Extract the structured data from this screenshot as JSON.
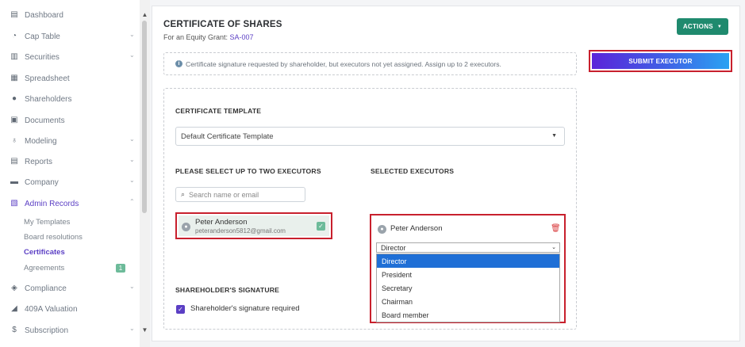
{
  "sidebar": {
    "items": [
      {
        "label": "Dashboard",
        "icon": "dashboard-icon",
        "chevron": false
      },
      {
        "label": "Cap Table",
        "icon": "pie-chart-icon",
        "chevron": true
      },
      {
        "label": "Securities",
        "icon": "clipboard-icon",
        "chevron": true
      },
      {
        "label": "Spreadsheet",
        "icon": "spreadsheet-icon",
        "chevron": false
      },
      {
        "label": "Shareholders",
        "icon": "person-icon",
        "chevron": false
      },
      {
        "label": "Documents",
        "icon": "document-icon",
        "chevron": false
      },
      {
        "label": "Modeling",
        "icon": "lightbulb-icon",
        "chevron": true
      },
      {
        "label": "Reports",
        "icon": "report-icon",
        "chevron": true
      },
      {
        "label": "Company",
        "icon": "briefcase-icon",
        "chevron": true
      },
      {
        "label": "Admin Records",
        "icon": "records-icon",
        "chevron": true,
        "active": true
      },
      {
        "label": "Compliance",
        "icon": "compliance-icon",
        "chevron": true
      },
      {
        "label": "409A Valuation",
        "icon": "valuation-icon",
        "chevron": false
      },
      {
        "label": "Subscription",
        "icon": "dollar-icon",
        "chevron": true
      }
    ],
    "subitems": [
      {
        "label": "My Templates"
      },
      {
        "label": "Board resolutions"
      },
      {
        "label": "Certificates",
        "active": true
      },
      {
        "label": "Agreements",
        "badge": "1"
      }
    ]
  },
  "header": {
    "title": "CERTIFICATE OF SHARES",
    "subtitle_prefix": "For an Equity Grant: ",
    "grant_id": "SA-007",
    "actions_label": "ACTIONS"
  },
  "info": {
    "message": "Certificate signature requested by shareholder, but executors not yet assigned. Assign up to 2 executors."
  },
  "submit_label": "SUBMIT EXECUTOR",
  "template": {
    "label": "CERTIFICATE TEMPLATE",
    "selected": "Default Certificate Template"
  },
  "executors": {
    "select_label": "PLEASE SELECT UP TO TWO EXECUTORS",
    "search_placeholder": "Search name or email",
    "candidate": {
      "name": "Peter Anderson",
      "email": "peteranderson5812@gmail.com"
    },
    "selected_label": "SELECTED EXECUTORS",
    "selected": {
      "name": "Peter Anderson",
      "role": "Director",
      "role_options": [
        "Director",
        "President",
        "Secretary",
        "Chairman",
        "Board member"
      ],
      "highlighted": "Director"
    }
  },
  "signature": {
    "label": "SHAREHOLDER'S SIGNATURE",
    "checkbox_label": "Shareholder's signature required"
  },
  "colors": {
    "accent": "#5b3fc4",
    "actions_bg": "#1f8a6e",
    "highlight_border": "#c8202d",
    "dropdown_highlight": "#1f6fd6"
  }
}
